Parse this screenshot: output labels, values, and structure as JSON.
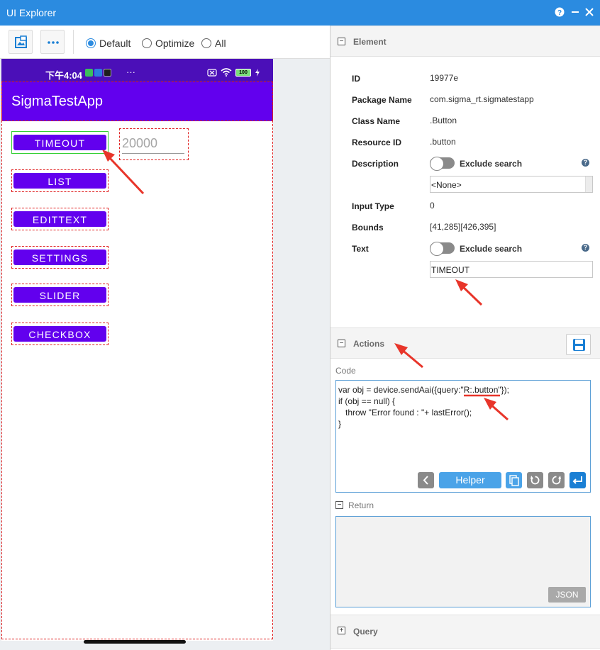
{
  "window": {
    "title": "UI Explorer"
  },
  "toolbar": {
    "radios": [
      {
        "label": "Default",
        "selected": true
      },
      {
        "label": "Optimize",
        "selected": false
      },
      {
        "label": "All",
        "selected": false
      }
    ]
  },
  "device": {
    "status_time": "下午4:04",
    "status_more": "···",
    "battery": "100",
    "app_title": "SigmaTestApp",
    "buttons": [
      "TIMEOUT",
      "LIST",
      "EDITTEXT",
      "SETTINGS",
      "SLIDER",
      "CHECKBOX"
    ],
    "edit_value": "20000"
  },
  "element": {
    "section_label": "Element",
    "props": {
      "id_label": "ID",
      "id_value": "19977e",
      "package_label": "Package Name",
      "package_value": "com.sigma_rt.sigmatestapp",
      "class_label": "Class Name",
      "class_value": ".Button",
      "resource_label": "Resource ID",
      "resource_value": ".button",
      "description_label": "Description",
      "description_value": "<None>",
      "exclude_label": "Exclude search",
      "input_type_label": "Input Type",
      "input_type_value": "0",
      "bounds_label": "Bounds",
      "bounds_value": "[41,285][426,395]",
      "text_label": "Text",
      "text_value": "TIMEOUT"
    }
  },
  "actions": {
    "section_label": "Actions",
    "code_label": "Code",
    "code": "var obj = device.sendAai({query:\"R:.button\"});\nif (obj == null) {\n   throw \"Error found : \"+ lastError();\n}",
    "helper_label": "Helper",
    "return_label": "Return",
    "json_label": "JSON"
  },
  "query": {
    "section_label": "Query"
  },
  "colors": {
    "accent": "#2b8be0",
    "app_primary": "#6200ee",
    "status_bar": "#4b0fb8",
    "annotation_red": "#e02020"
  }
}
